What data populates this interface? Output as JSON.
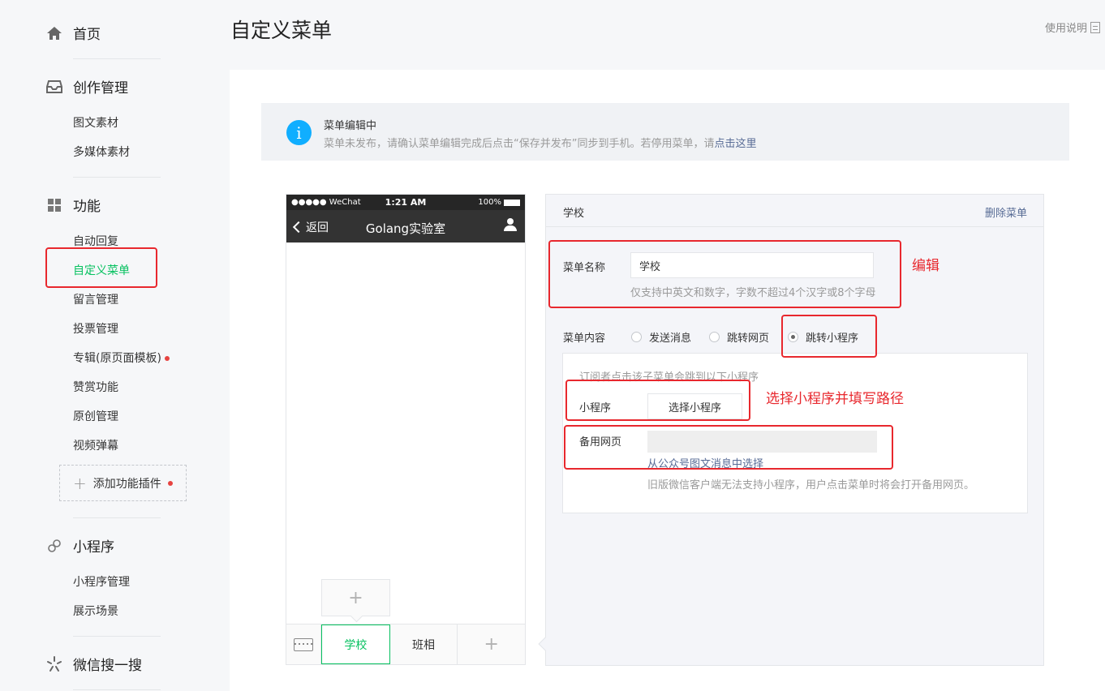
{
  "sidebar": {
    "home": "首页",
    "creation": {
      "title": "创作管理",
      "items": [
        "图文素材",
        "多媒体素材"
      ]
    },
    "features": {
      "title": "功能",
      "items": [
        "自动回复",
        "自定义菜单",
        "留言管理",
        "投票管理",
        "专辑(原页面模板)",
        "赞赏功能",
        "原创管理",
        "视频弹幕"
      ],
      "add_plugin": "添加功能插件"
    },
    "miniprogram": {
      "title": "小程序",
      "items": [
        "小程序管理",
        "展示场景"
      ]
    },
    "search": {
      "title": "微信搜一搜"
    }
  },
  "header": {
    "title": "自定义菜单",
    "help": "使用说明"
  },
  "notice": {
    "title": "菜单编辑中",
    "desc": "菜单未发布，请确认菜单编辑完成后点击“保存并发布”同步到手机。若停用菜单，请",
    "link": "点击这里"
  },
  "phone": {
    "carrier": "●●●●● WeChat",
    "time": "1:21 AM",
    "battery": "100%",
    "back": "返回",
    "account": "Golang实验室",
    "sub_add": "+",
    "menus": [
      "学校",
      "班相"
    ],
    "menu_add": "+"
  },
  "editor": {
    "menu_name": "学校",
    "delete": "删除菜单",
    "name_label": "菜单名称",
    "name_value": "学校",
    "name_hint": "仅支持中英文和数字，字数不超过4个汉字或8个字母",
    "content_label": "菜单内容",
    "options": [
      "发送消息",
      "跳转网页",
      "跳转小程序"
    ],
    "selected_option": "跳转小程序",
    "mp_desc": "订阅者点击该子菜单会跳到以下小程序",
    "mp_label": "小程序",
    "mp_button": "选择小程序",
    "backup_label": "备用网页",
    "backup_link": "从公众号图文消息中选择",
    "backup_hint": "旧版微信客户端无法支持小程序，用户点击菜单时将会打开备用网页。"
  },
  "annotations": {
    "edit": "编辑",
    "choose_mp": "选择小程序并填写路径"
  },
  "colors": {
    "accent": "#07c160",
    "link": "#576b95",
    "annotation": "#e8282e",
    "info": "#10aeff"
  }
}
